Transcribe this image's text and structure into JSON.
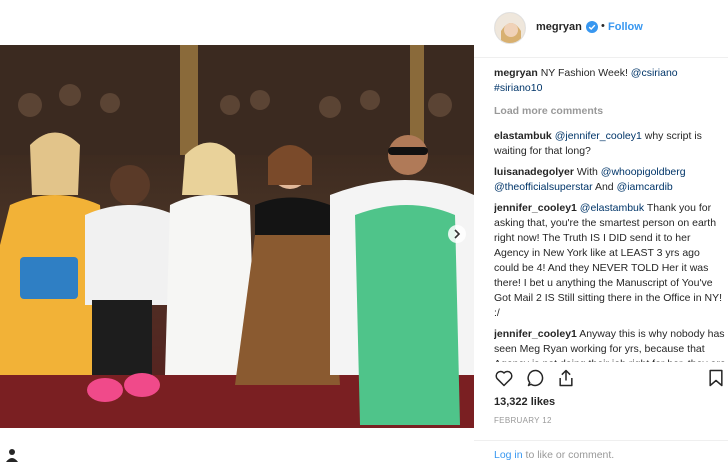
{
  "post": {
    "username": "megryan",
    "follow_label": "Follow",
    "separator": "•",
    "caption": {
      "user": "megryan",
      "text": "NY Fashion Week! ",
      "mention": "@csiriano",
      "hashtag": "#siriano10"
    },
    "load_more": "Load more comments",
    "comments": [
      {
        "user": "elastambuk",
        "mention": "@jennifer_cooley1",
        "text": " why script is waiting for that long?"
      },
      {
        "user": "luisanadegolyer",
        "text_before": "With ",
        "mentions": [
          "@whoopigoldberg",
          "@theofficialsuperstar",
          "@iamcardib"
        ],
        "joiner": " And "
      },
      {
        "user": "jennifer_cooley1",
        "mention": "@elastambuk",
        "text": " Thank you for asking that, you're the smartest person on earth right now! The Truth IS I DID send it to her Agency in New York like at LEAST 3 yrs ago could be 4! And they NEVER TOLD Her it was there! I bet u anything the Manuscript of You've Got Mail 2 IS Still sitting there in the Office in NY! :/"
      },
      {
        "user": "jennifer_cooley1",
        "text": " Anyway this is why nobody has seen Meg Ryan working for yrs, because that Agency is not doing their job right for her, they are not looking for"
      }
    ],
    "likes": "13,322 likes",
    "date": "FEBRUARY 12",
    "footer": {
      "login": "Log in",
      "rest": " to like or comment."
    }
  },
  "icons": {
    "like": "heart-icon",
    "comment": "comment-icon",
    "share": "share-icon",
    "save": "bookmark-icon",
    "verified": "verified-badge-icon",
    "next": "chevron-right-icon"
  },
  "colors": {
    "link_blue": "#3897f0",
    "mention_blue": "#003569",
    "muted": "#999999",
    "text": "#262626"
  }
}
